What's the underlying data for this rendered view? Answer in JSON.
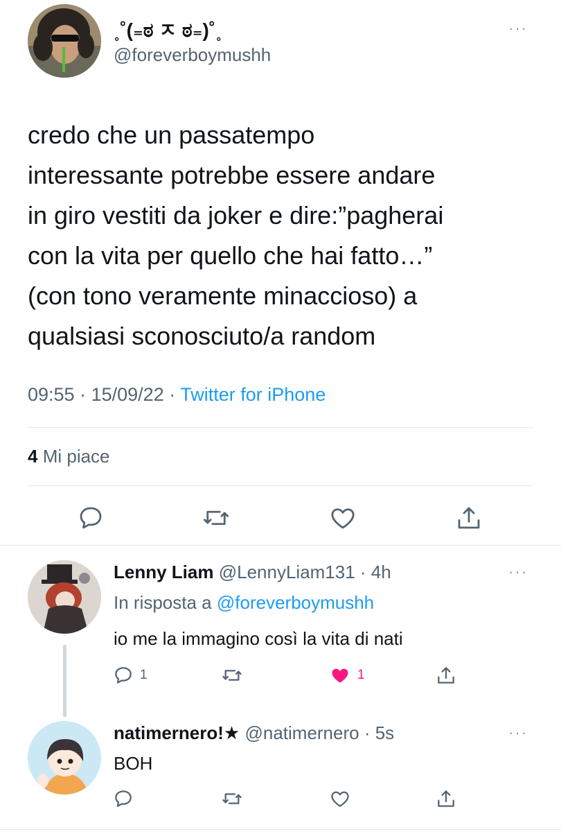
{
  "main_tweet": {
    "display_name": "˳˚(₌ಠ ㅈ ಠ₌)˚˳",
    "handle": "@foreverboymushh",
    "text_lines": [
      "credo che un passatempo",
      "interessante potrebbe essere andare",
      "in giro vestiti da joker e dire:”pagherai",
      "con la vita per quello che hai fatto…”",
      "(con tono veramente minaccioso) a",
      "qualsiasi sconosciuto/a random"
    ],
    "time": "09:55",
    "sep1": "·",
    "date": "15/09/22",
    "sep2": "·",
    "source": "Twitter for iPhone",
    "likes_count": "4",
    "likes_label": "Mi piace"
  },
  "replies": [
    {
      "display_name": "Lenny Liam",
      "handle": "@LennyLiam131",
      "time": "· 4h",
      "reply_prefix": "In risposta a",
      "reply_to": "@foreverboymushh",
      "text": "io me la immagino così la vita di nati",
      "reply_count": "1",
      "like_count": "1"
    },
    {
      "display_name": "natimernero!★",
      "handle": "@natimernero",
      "time": "· 5s",
      "text": "BOH"
    }
  ],
  "more_glyph": "···",
  "colors": {
    "accent": "#1d9bf0",
    "like": "#f91880",
    "muted": "#536471"
  }
}
